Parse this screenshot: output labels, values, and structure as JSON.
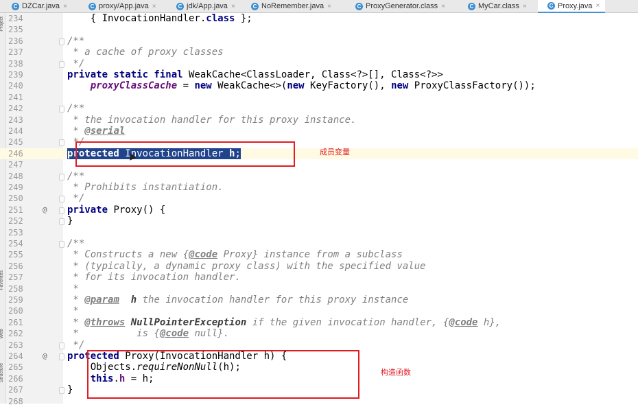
{
  "tabs": [
    {
      "label": "DZCar.java",
      "icon": "C",
      "active": false
    },
    {
      "label": "proxy/App.java",
      "icon": "C",
      "active": false
    },
    {
      "label": "jdk/App.java",
      "icon": "C",
      "active": false
    },
    {
      "label": "NoRemember.java",
      "icon": "C",
      "active": false
    },
    {
      "label": "ProxyGenerator.class",
      "icon": "C",
      "active": false
    },
    {
      "label": "MyCar.class",
      "icon": "C",
      "active": false
    },
    {
      "label": "Proxy.java",
      "icon": "C",
      "active": true
    }
  ],
  "side_labels": [
    "Project",
    "Favorites",
    "Web",
    "Structure"
  ],
  "lines": [
    {
      "n": "234",
      "html": "    { InvocationHandler.<span class='kw'>class</span> };"
    },
    {
      "n": "235",
      "html": ""
    },
    {
      "n": "236",
      "html": "<span class='cm'>/**</span>"
    },
    {
      "n": "237",
      "html": "<span class='cm'> * a cache of proxy classes</span>"
    },
    {
      "n": "238",
      "html": "<span class='cm'> */</span>"
    },
    {
      "n": "239",
      "html": "<span class='kw'>private static final</span> WeakCache&lt;ClassLoader, Class&lt;?&gt;[], Class&lt;?&gt;&gt;"
    },
    {
      "n": "240",
      "html": "    <span class='fld'>proxyClassCache</span> = <span class='kw'>new</span> WeakCache&lt;&gt;(<span class='kw'>new</span> KeyFactory(), <span class='kw'>new</span> ProxyClassFactory());"
    },
    {
      "n": "241",
      "html": ""
    },
    {
      "n": "242",
      "html": "<span class='cm'>/**</span>"
    },
    {
      "n": "243",
      "html": "<span class='cm'> * the invocation handler for this proxy instance.</span>"
    },
    {
      "n": "244",
      "html": "<span class='cm'> * </span><span class='tag'>@serial</span>"
    },
    {
      "n": "245",
      "html": "<span class='cm'> */</span>"
    },
    {
      "n": "246",
      "html": "<span class='sel'><span class='kw'>protected</span> InvocationHandler <span class='kw'>h</span>;</span>",
      "current": true
    },
    {
      "n": "247",
      "html": ""
    },
    {
      "n": "248",
      "html": "<span class='cm'>/**</span>"
    },
    {
      "n": "249",
      "html": "<span class='cm'> * Prohibits instantiation.</span>"
    },
    {
      "n": "250",
      "html": "<span class='cm'> */</span>"
    },
    {
      "n": "251",
      "html": "<span class='kw'>private</span> Proxy() {",
      "ann": "@"
    },
    {
      "n": "252",
      "html": "}"
    },
    {
      "n": "253",
      "html": ""
    },
    {
      "n": "254",
      "html": "<span class='cm'>/**</span>"
    },
    {
      "n": "255",
      "html": "<span class='cm'> * Constructs a new {</span><span class='tag'>@code</span><span class='cm'> Proxy} instance from a subclass</span>"
    },
    {
      "n": "256",
      "html": "<span class='cm'> * (typically, a dynamic proxy class) with the specified value</span>"
    },
    {
      "n": "257",
      "html": "<span class='cm'> * for its invocation handler.</span>"
    },
    {
      "n": "258",
      "html": "<span class='cm'> *</span>"
    },
    {
      "n": "259",
      "html": "<span class='cm'> * </span><span class='tag'>@param</span><span class='cm'>  </span><span class='tagb'>h</span><span class='cm'> the invocation handler for this proxy instance</span>"
    },
    {
      "n": "260",
      "html": "<span class='cm'> *</span>"
    },
    {
      "n": "261",
      "html": "<span class='cm'> * </span><span class='tag'>@throws</span><span class='cm'> </span><span class='tagb'>NullPointerException</span><span class='cm'> if the given invocation handler, {</span><span class='tag'>@code</span><span class='cm'> h},</span>"
    },
    {
      "n": "262",
      "html": "<span class='cm'> *          is {</span><span class='tag'>@code</span><span class='cm'> null}.</span>"
    },
    {
      "n": "263",
      "html": "<span class='cm'> */</span>"
    },
    {
      "n": "264",
      "html": "<span class='kw'>protected</span> Proxy(InvocationHandler h) {",
      "ann": "@"
    },
    {
      "n": "265",
      "html": "    Objects.<span class='ital'>requireNonNull</span>(h);"
    },
    {
      "n": "266",
      "html": "    <span class='kw'>this</span>.<span class='fld2'>h</span> = h;"
    },
    {
      "n": "267",
      "html": "}"
    },
    {
      "n": "268",
      "html": ""
    }
  ],
  "annotations": {
    "member_variable_note": "成员变量",
    "constructor_note": "构造函数"
  }
}
